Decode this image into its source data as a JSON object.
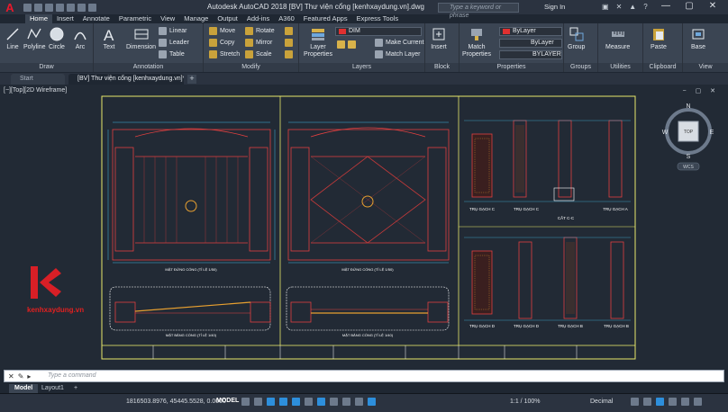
{
  "window": {
    "title": "Autodesk AutoCAD 2018   [BV] Thư viện cổng [kenhxaydung.vn].dwg",
    "app_logo": "A",
    "search_placeholder": "Type a keyword or phrase",
    "sign_in": "Sign In",
    "controls": [
      "—",
      "▢",
      "✕"
    ]
  },
  "ribbon_tabs": [
    "Home",
    "Insert",
    "Annotate",
    "Parametric",
    "View",
    "Manage",
    "Output",
    "Add-ins",
    "A360",
    "Featured Apps",
    "Express Tools"
  ],
  "active_tab": "Home",
  "ribbon": {
    "draw": {
      "label": "Draw",
      "line": "Line",
      "polyline": "Polyline",
      "circle": "Circle",
      "arc": "Arc"
    },
    "annotation": {
      "label": "Annotation",
      "text": "Text",
      "dimension": "Dimension",
      "linear": "Linear",
      "leader": "Leader",
      "table": "Table"
    },
    "modify": {
      "label": "Modify",
      "move": "Move",
      "rotate": "Rotate",
      "copy": "Copy",
      "mirror": "Mirror",
      "stretch": "Stretch",
      "scale": "Scale"
    },
    "layers": {
      "label": "Layers",
      "layer_properties": "Layer Properties",
      "current_layer": "DIM",
      "make_current": "Make Current",
      "match_layer": "Match Layer"
    },
    "block": {
      "label": "Block",
      "insert": "Insert"
    },
    "properties": {
      "label": "Properties",
      "match_properties": "Match Properties",
      "color": "ByLayer",
      "linetype": "ByLayer",
      "lineweight": "BYLAYER"
    },
    "groups": {
      "label": "Groups",
      "group": "Group"
    },
    "utilities": {
      "label": "Utilities",
      "measure": "Measure"
    },
    "clipboard": {
      "label": "Clipboard",
      "paste": "Paste"
    },
    "view": {
      "label": "View",
      "base": "Base"
    }
  },
  "file_tabs": [
    "Start",
    "[BV] Thư viện cổng [kenhxaydung.vn]*"
  ],
  "drawing": {
    "view_label": "[−][Top][2D Wireframe]",
    "viewcube": {
      "n": "N",
      "s": "S",
      "e": "E",
      "w": "W",
      "top": "TOP",
      "wcs": "WCS"
    },
    "brand": "kenhxaydung.vn",
    "view_titles": {
      "elev1": "MẶT ĐỨNG CỔNG (TỈ LỆ 1/50)",
      "elev2": "MẶT ĐỨNG CỔNG (TỈ LỆ 1/50)",
      "plan1": "MẶT BẰNG CỔNG (TỈ LỆ 1/40)",
      "plan2": "MẶT BẰNG CỔNG (TỈ LỆ 1/40)",
      "pier_c1": "TRỤ GẠCH C",
      "pier_c2": "TRỤ GẠCH C",
      "section_cc": "CẮT C-C",
      "pier_a": "TRỤ GẠCH A",
      "pier_d1": "TRỤ GẠCH D",
      "pier_d2": "TRỤ GẠCH D",
      "pier_b1": "TRỤ GẠCH B",
      "pier_b2": "TRỤ GẠCH B"
    }
  },
  "command_line": {
    "placeholder": "Type a command"
  },
  "layout_tabs": [
    "Model",
    "Layout1",
    "+"
  ],
  "active_layout": "Model",
  "status": {
    "coordinates": "1816503.8976, 45445.5528, 0.0000",
    "mode": "MODEL",
    "annotation_scale": "1:1 / 100%",
    "units": "Decimal"
  }
}
